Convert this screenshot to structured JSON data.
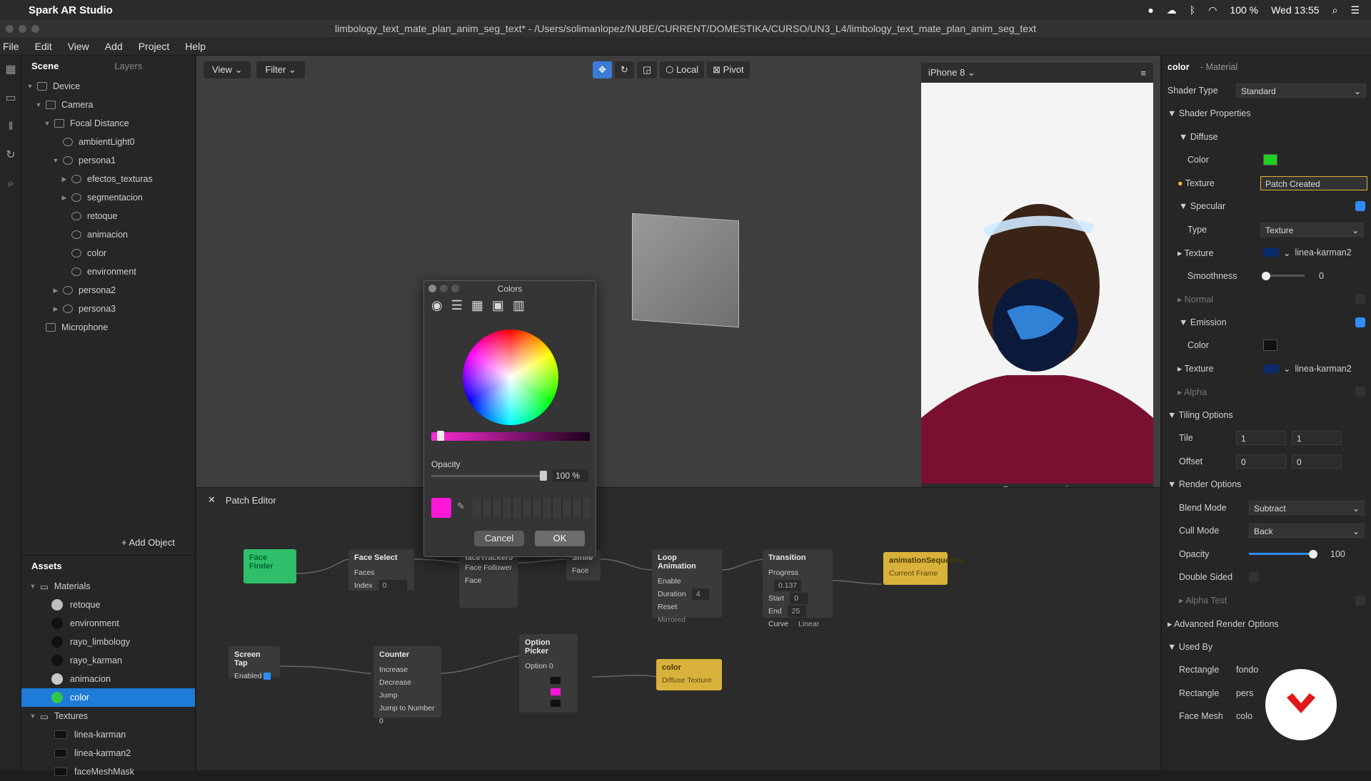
{
  "macbar": {
    "app": "Spark AR Studio",
    "battery": "100 %",
    "clock": "Wed 13:55"
  },
  "title": "limbology_text_mate_plan_anim_seg_text* - /Users/solimanlopez/NUBE/CURRENT/DOMESTIKA/CURSO/UN3_L4/limbology_text_mate_plan_anim_seg_text",
  "menu": [
    "File",
    "Edit",
    "View",
    "Add",
    "Project",
    "Help"
  ],
  "scene": {
    "tabs": [
      "Scene",
      "Layers"
    ],
    "tree": [
      {
        "label": "Device",
        "indent": 0,
        "arrow": "▼"
      },
      {
        "label": "Camera",
        "indent": 1,
        "arrow": "▼"
      },
      {
        "label": "Focal Distance",
        "indent": 2,
        "arrow": "▼"
      },
      {
        "label": "ambientLight0",
        "indent": 3,
        "arrow": ""
      },
      {
        "label": "persona1",
        "indent": 3,
        "arrow": "▼"
      },
      {
        "label": "efectos_texturas",
        "indent": 4,
        "arrow": "▶"
      },
      {
        "label": "segmentacion",
        "indent": 4,
        "arrow": "▶"
      },
      {
        "label": "retoque",
        "indent": 4,
        "arrow": ""
      },
      {
        "label": "animacion",
        "indent": 4,
        "arrow": ""
      },
      {
        "label": "color",
        "indent": 4,
        "arrow": ""
      },
      {
        "label": "environment",
        "indent": 4,
        "arrow": ""
      },
      {
        "label": "persona2",
        "indent": 3,
        "arrow": "▶"
      },
      {
        "label": "persona3",
        "indent": 3,
        "arrow": "▶"
      },
      {
        "label": "Microphone",
        "indent": 1,
        "arrow": ""
      }
    ],
    "add_object": "+ Add Object"
  },
  "assets": {
    "title": "Assets",
    "materials_label": "Materials",
    "materials": [
      {
        "label": "retoque",
        "color": "#bdbdbd"
      },
      {
        "label": "environment",
        "color": "#111111"
      },
      {
        "label": "rayo_limbology",
        "color": "#111111"
      },
      {
        "label": "rayo_karman",
        "color": "#111111"
      },
      {
        "label": "animacion",
        "color": "#c8c8c8"
      },
      {
        "label": "color",
        "color": "#2fc94a",
        "selected": true
      }
    ],
    "textures_label": "Textures",
    "textures": [
      "linea-karman",
      "linea-karman2",
      "faceMeshMask"
    ]
  },
  "viewport": {
    "view": "View",
    "filter": "Filter",
    "local": "Local",
    "pivot": "Pivot"
  },
  "preview": {
    "device": "iPhone 8"
  },
  "patch": {
    "title": "Patch Editor",
    "nodes": {
      "face_finder": "Face Finder",
      "face_select": {
        "title": "Face Select",
        "faces": "Faces",
        "index": "Index",
        "index_val": "0"
      },
      "face_tracker": {
        "title": "faceTracker0",
        "sub": "Face Follower",
        "face": "Face"
      },
      "smile": {
        "title": "Smile",
        "face": "Face"
      },
      "loop": {
        "title": "Loop Animation",
        "enable": "Enable",
        "duration": "Duration",
        "duration_val": "4",
        "reset": "Reset",
        "mirrored": "Mirrored"
      },
      "transition": {
        "title": "Transition",
        "progress": "Progress",
        "progress_val": "0.137",
        "start": "Start",
        "start_val": "0",
        "end": "End",
        "end_val": "25",
        "curve": "Curve",
        "curve_val": "Linear"
      },
      "anim_seq": {
        "title": "animationSequence",
        "frame": "Current Frame"
      },
      "screen_tap": {
        "title": "Screen Tap",
        "enabled": "Enabled"
      },
      "counter": {
        "title": "Counter",
        "increase": "Increase",
        "decrease": "Decrease",
        "jump": "Jump",
        "jump_to": "Jump to Number",
        "jump_val": "0"
      },
      "option_picker": {
        "title": "Option Picker",
        "option": "Option",
        "option_val": "0"
      },
      "color_node": {
        "title": "color",
        "port": "Diffuse Texture"
      }
    }
  },
  "colors_dialog": {
    "title": "Colors",
    "opacity_label": "Opacity",
    "opacity_value": "100 %",
    "opacity_fraction": 1.0,
    "cancel": "Cancel",
    "ok": "OK",
    "selected_color": "#ff17d8"
  },
  "inspector": {
    "name": "color",
    "kind": "- Material",
    "shader_type_label": "Shader Type",
    "shader_type": "Standard",
    "shader_props": "Shader Properties",
    "diffuse": "Diffuse",
    "color_label": "Color",
    "diffuse_color": "#1fd11f",
    "texture_label": "Texture",
    "texture_value": "Patch Created",
    "specular": "Specular",
    "type_label": "Type",
    "type_value": "Texture",
    "spec_texture": "linea-karman2",
    "smoothness_label": "Smoothness",
    "smoothness_value": "0",
    "normal": "Normal",
    "emission": "Emission",
    "emission_color": "#111111",
    "emission_texture": "linea-karman2",
    "alpha": "Alpha",
    "tiling": "Tiling Options",
    "tile_label": "Tile",
    "tile_x": "1",
    "tile_y": "1",
    "offset_label": "Offset",
    "offset_x": "0",
    "offset_y": "0",
    "render": "Render Options",
    "blend_label": "Blend Mode",
    "blend_value": "Subtract",
    "cull_label": "Cull Mode",
    "cull_value": "Back",
    "opacity_label": "Opacity",
    "opacity_value": "100",
    "double_sided": "Double Sided",
    "alpha_test": "Alpha Test",
    "advanced": "Advanced Render Options",
    "used_by": "Used By",
    "used": [
      {
        "type": "Rectangle",
        "name": "fondo"
      },
      {
        "type": "Rectangle",
        "name": "pers"
      },
      {
        "type": "Face Mesh",
        "name": "colo"
      }
    ]
  }
}
